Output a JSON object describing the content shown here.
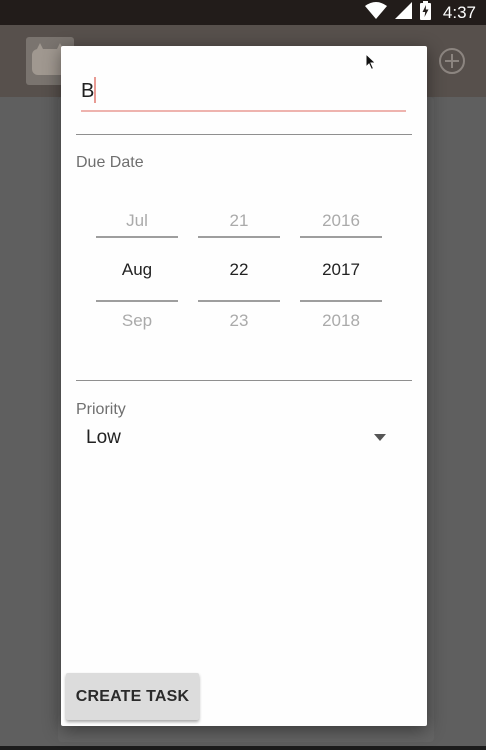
{
  "status_bar": {
    "time": "4:37",
    "icons": [
      "wifi-icon",
      "cell-signal-icon",
      "battery-charging-icon"
    ]
  },
  "app_bar": {
    "icons": [
      "app-logo",
      "add-circle-icon"
    ]
  },
  "dialog": {
    "title_input": {
      "value": "B"
    },
    "due_date": {
      "label": "Due Date",
      "month": {
        "prev": "Jul",
        "current": "Aug",
        "next": "Sep"
      },
      "day": {
        "prev": "21",
        "current": "22",
        "next": "23"
      },
      "year": {
        "prev": "2016",
        "current": "2017",
        "next": "2018"
      }
    },
    "priority": {
      "label": "Priority",
      "selected": "Low"
    },
    "create_button": "CREATE TASK"
  },
  "colors": {
    "accent_underline": "#eeb3ae",
    "dialog_bg": "#fefefe",
    "scrim_bg": "#5e5e5e",
    "status_bar_bg": "#221c1a"
  }
}
